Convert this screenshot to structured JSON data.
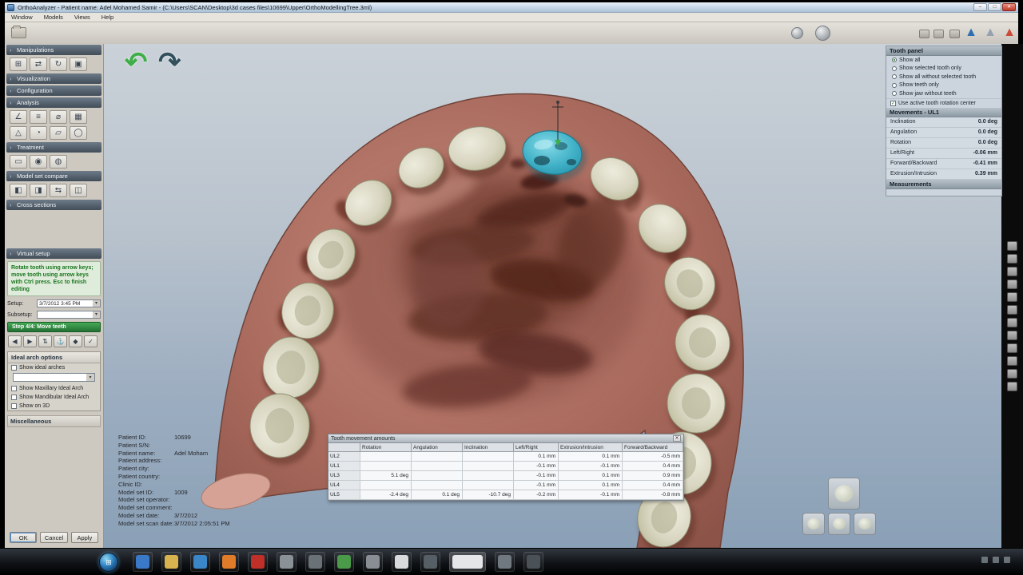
{
  "titlebar": {
    "title": "OrthoAnalyzer - Patient name: Adel Mohamed Samir - (C:\\Users\\SCAN\\Desktop\\3d cases files\\10699\\Upper\\OrthoModellingTree.3ml)",
    "minimize": "–",
    "maximize": "□",
    "close": "✕"
  },
  "menubar": {
    "items": [
      "Window",
      "Models",
      "Views",
      "Help"
    ]
  },
  "toolbar": {
    "triangle_logos": [
      {
        "name": "triangle-logo-blue",
        "glyph": "▲",
        "color": "#2e6fb0"
      },
      {
        "name": "triangle-logo-gray",
        "glyph": "▲",
        "color": "#93a2ae"
      },
      {
        "name": "triangle-logo-red",
        "glyph": "▲",
        "color": "#cc4a38"
      }
    ]
  },
  "sidebar": {
    "sections": [
      {
        "title": "Manipulations",
        "icons": [
          {
            "name": "transform-tool-icon",
            "glyph": "⊞"
          },
          {
            "name": "mirror-tool-icon",
            "glyph": "⇄"
          },
          {
            "name": "rotate-tool-icon",
            "glyph": "↻"
          },
          {
            "name": "align-tool-icon",
            "glyph": "▣"
          }
        ]
      },
      {
        "title": "Visualization",
        "icons": []
      },
      {
        "title": "Configuration",
        "icons": []
      },
      {
        "title": "Analysis",
        "icons": [
          {
            "name": "angle-measure-icon",
            "glyph": "∠"
          },
          {
            "name": "distance-measure-icon",
            "glyph": "≡"
          },
          {
            "name": "diameter-measure-icon",
            "glyph": "⌀"
          },
          {
            "name": "grid-analysis-icon",
            "glyph": "▦"
          },
          {
            "name": "plane-analysis-icon",
            "glyph": "△"
          },
          {
            "name": "arc-analysis-icon",
            "glyph": "◔"
          },
          {
            "name": "section-analysis-icon",
            "glyph": "▱"
          },
          {
            "name": "circle-analysis-icon",
            "glyph": "◯"
          }
        ]
      },
      {
        "title": "Treatment",
        "icons": [
          {
            "name": "spacer-tool-icon",
            "glyph": "▭"
          },
          {
            "name": "bracket-tool-icon",
            "glyph": "◉"
          },
          {
            "name": "wire-tool-icon",
            "glyph": "◍"
          }
        ]
      },
      {
        "title": "Model set compare",
        "icons": [
          {
            "name": "compare-left-icon",
            "glyph": "◧"
          },
          {
            "name": "compare-right-icon",
            "glyph": "◨"
          },
          {
            "name": "swap-models-icon",
            "glyph": "⇆"
          },
          {
            "name": "overlay-models-icon",
            "glyph": "◫"
          }
        ]
      },
      {
        "title": "Cross sections",
        "icons": []
      }
    ],
    "virtual_setup": {
      "title": "Virtual setup",
      "instructions": "Rotate tooth using arrow keys; move tooth using arrow keys with Ctrl press. Esc to finish editing",
      "setup_label": "Setup:",
      "setup_value": "3/7/2012  3:45 PM",
      "subsetup_label": "Subsetup:",
      "subsetup_value": "",
      "step_label": "Step 4/4: Move teeth",
      "controls": [
        {
          "name": "prev-step-icon",
          "glyph": "◀"
        },
        {
          "name": "next-step-icon",
          "glyph": "▶"
        },
        {
          "name": "move-tooth-icon",
          "glyph": "⇅"
        },
        {
          "name": "anchor-icon",
          "glyph": "⚓"
        },
        {
          "name": "lock-icon",
          "glyph": "◆"
        },
        {
          "name": "accept-icon",
          "glyph": "✓"
        }
      ]
    },
    "ideal_arch": {
      "title": "Ideal arch options",
      "show_arches_label": "Show ideal arches",
      "arch_type_value": "",
      "options": [
        {
          "label": "Show Maxillary Ideal Arch",
          "checked": false
        },
        {
          "label": "Show Mandibular Ideal Arch",
          "checked": false
        },
        {
          "label": "Show on 3D",
          "checked": false
        }
      ]
    },
    "misc_title": "Miscellaneous",
    "buttons": [
      {
        "label": "OK",
        "primary": true
      },
      {
        "label": "Cancel"
      },
      {
        "label": "Apply"
      }
    ]
  },
  "viewport": {
    "undo_glyph": "↶",
    "redo_glyph": "↷",
    "selected_tooth": "UL1",
    "selected_tooth_color": "#3fb0c6"
  },
  "patient_info": {
    "lines": [
      {
        "label": "Patient ID:",
        "value": "10699"
      },
      {
        "label": "Patient S/N:",
        "value": ""
      },
      {
        "label": "Patient name:",
        "value": "Adel Moham"
      },
      {
        "label": "Patient address:",
        "value": ""
      },
      {
        "label": "Patient city:",
        "value": ""
      },
      {
        "label": "Patient country:",
        "value": ""
      },
      {
        "label": "Clinic ID:",
        "value": ""
      },
      {
        "label": "Model set ID:",
        "value": "1009"
      },
      {
        "label": "Model set operator:",
        "value": ""
      },
      {
        "label": "Model set comment:",
        "value": ""
      },
      {
        "label": "Model set date:",
        "value": "3/7/2012"
      },
      {
        "label": "Model set scan date:",
        "value": "3/7/2012  2:05:51 PM"
      }
    ]
  },
  "movement_table": {
    "title": "Tooth movement amounts",
    "close_glyph": "✕",
    "columns": [
      "",
      "Rotation",
      "Angulation",
      "Inclination",
      "Left/Right",
      "Extrusion/Intrusion",
      "Forward/Backward"
    ],
    "selected_cell": {
      "row": "UL2",
      "column": "Rotation"
    },
    "rows": [
      {
        "label": "UL2",
        "values": [
          "",
          "",
          "",
          "0.1 mm",
          "0.1 mm",
          "-0.5 mm"
        ]
      },
      {
        "label": "UL1",
        "values": [
          "",
          "",
          "",
          "-0.1 mm",
          "-0.1 mm",
          "0.4 mm"
        ]
      },
      {
        "label": "UL3",
        "values": [
          "5.1 deg",
          "",
          "",
          "-0.1 mm",
          "0.1 mm",
          "0.9 mm"
        ]
      },
      {
        "label": "UL4",
        "values": [
          "",
          "",
          "",
          "-0.1 mm",
          "0.1 mm",
          "0.4 mm"
        ]
      },
      {
        "label": "UL5",
        "values": [
          "-2.4 deg",
          "0.1 deg",
          "-10.7 deg",
          "-0.2 mm",
          "-0.1 mm",
          "-0.8 mm"
        ]
      }
    ]
  },
  "tooth_panel": {
    "title": "Tooth panel",
    "radios": [
      {
        "label": "Show all",
        "checked": true
      },
      {
        "label": "Show selected tooth only",
        "checked": false
      },
      {
        "label": "Show all without selected tooth",
        "checked": false
      },
      {
        "label": "Show teeth only",
        "checked": false
      },
      {
        "label": "Show jaw without teeth",
        "checked": false
      }
    ],
    "rotation_center_check": "✓",
    "rotation_center_label": "Use active tooth rotation center",
    "movements_title": "Movements - UL1",
    "movements": [
      {
        "label": "Inclination",
        "value": "0.0 deg"
      },
      {
        "label": "Angulation",
        "value": "0.0 deg"
      },
      {
        "label": "Rotation",
        "value": "0.0 deg"
      },
      {
        "label": "Left/Right",
        "value": "-0.06 mm"
      },
      {
        "label": "Forward/Backward",
        "value": "-0.41 mm"
      },
      {
        "label": "Extrusion/Intrusion",
        "value": "0.39 mm"
      }
    ],
    "measurements_title": "Measurements"
  },
  "right_strip": {
    "icons": [
      "pan-view-icon",
      "zoom-view-icon",
      "rotate-view-icon",
      "fit-view-icon",
      "front-view-icon",
      "top-view-icon",
      "left-view-icon",
      "right-view-icon",
      "measure-view-icon",
      "screenshot-icon",
      "layers-icon",
      "settings-view-icon"
    ]
  },
  "view_controls": {
    "big": "model-orientation-button",
    "small": [
      "occlusal-view-button",
      "frontal-view-button",
      "lateral-view-button"
    ]
  },
  "taskbar": {
    "start": "⊞",
    "icons": [
      {
        "name": "internet-explorer-icon",
        "color": "#3a78c8"
      },
      {
        "name": "folder-icon",
        "color": "#d8b24e"
      },
      {
        "name": "media-player-icon",
        "color": "#3a86c8"
      },
      {
        "name": "firefox-icon",
        "color": "#e07b2a"
      },
      {
        "name": "adobe-reader-icon",
        "color": "#c03028"
      },
      {
        "name": "media-play-icon",
        "color": "#8a9298"
      },
      {
        "name": "app-icon-1",
        "color": "#6a7278"
      },
      {
        "name": "green-app-icon",
        "color": "#4a9a4a"
      },
      {
        "name": "app-icon-2",
        "color": "#888e94"
      },
      {
        "name": "document-icon",
        "color": "#d8dadc"
      },
      {
        "name": "app-icon-3",
        "color": "#565e66"
      },
      {
        "name": "open-window-button",
        "color": "#e4e6e8",
        "wide": true
      },
      {
        "name": "app-icon-4",
        "color": "#707880"
      },
      {
        "name": "app-icon-5",
        "color": "#4a5258"
      }
    ],
    "tray": [
      "tray-icon-1",
      "tray-icon-2",
      "tray-icon-3"
    ]
  }
}
